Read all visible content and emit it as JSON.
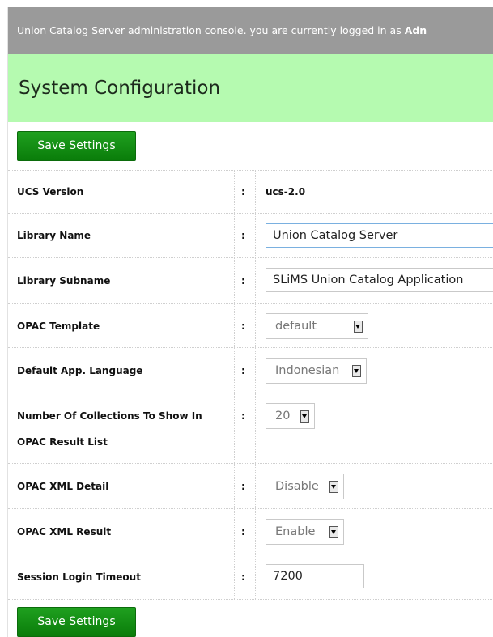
{
  "header": {
    "console_text": "Union Catalog Server administration console. you are currently logged in as ",
    "user_fragment": "Adn"
  },
  "page_title": "System Configuration",
  "save_button_label": "Save Settings",
  "settings": {
    "ucs_version": {
      "label": "UCS Version",
      "value": "ucs-2.0"
    },
    "library_name": {
      "label": "Library Name",
      "value": "Union Catalog Server"
    },
    "library_subname": {
      "label": "Library Subname",
      "value": "SLiMS Union Catalog Application"
    },
    "opac_template": {
      "label": "OPAC Template",
      "value": "default"
    },
    "default_language": {
      "label": "Default App. Language",
      "value": "Indonesian"
    },
    "num_collections": {
      "label": "Number Of Collections To Show In OPAC Result List",
      "value": "20"
    },
    "opac_xml_detail": {
      "label": "OPAC XML Detail",
      "value": "Disable"
    },
    "opac_xml_result": {
      "label": "OPAC XML Result",
      "value": "Enable"
    },
    "session_timeout": {
      "label": "Session Login Timeout",
      "value": "7200"
    }
  },
  "colon": ":"
}
